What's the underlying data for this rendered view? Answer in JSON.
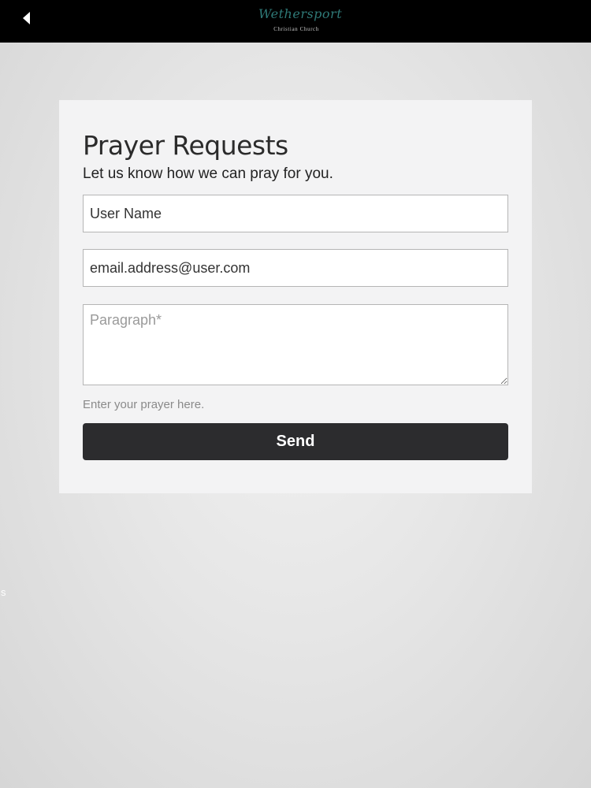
{
  "header": {
    "back_icon": "back-arrow-icon",
    "logo": {
      "script_text": "Wethersport",
      "subtitle": "Christian Church"
    }
  },
  "form": {
    "title": "Prayer Requests",
    "subtitle": "Let us know how we can pray for you.",
    "name_value": "User Name",
    "email_value": "email.address@user.com",
    "message_placeholder": "Paragraph*",
    "help_text": "Enter your prayer here.",
    "send_label": "Send"
  },
  "edge_mark": "s",
  "colors": {
    "header_bg": "#000000",
    "card_bg": "#f3f3f4",
    "button_bg": "#2c2c2e",
    "logo_accent": "#2f7a78"
  }
}
